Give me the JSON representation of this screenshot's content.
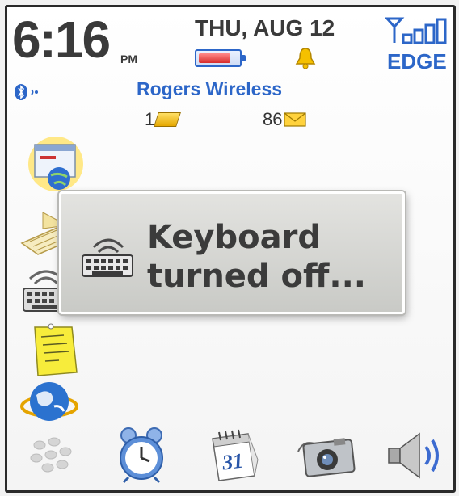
{
  "status_bar": {
    "time": "6:16",
    "ampm": "PM",
    "date": "THU, AUG 12",
    "network_type": "EDGE",
    "carrier": "Rogers Wireless",
    "battery_level": 0.82
  },
  "counters": {
    "sms": "1",
    "mail": "86"
  },
  "popup": {
    "line1": "Keyboard",
    "line2": "turned off..."
  },
  "icons": {
    "side": [
      "browser-icon",
      "memo-icon",
      "keyboard-icon",
      "sticky-note-icon",
      "globe-icon"
    ],
    "bottom": [
      "applications-icon",
      "alarm-clock-icon",
      "calendar-icon",
      "camera-icon",
      "speaker-icon"
    ]
  },
  "calendar_day": "31",
  "colors": {
    "accent_blue": "#2c66c8",
    "text_dark": "#3a3a3a",
    "popup_bg": "#d6d6d3"
  }
}
